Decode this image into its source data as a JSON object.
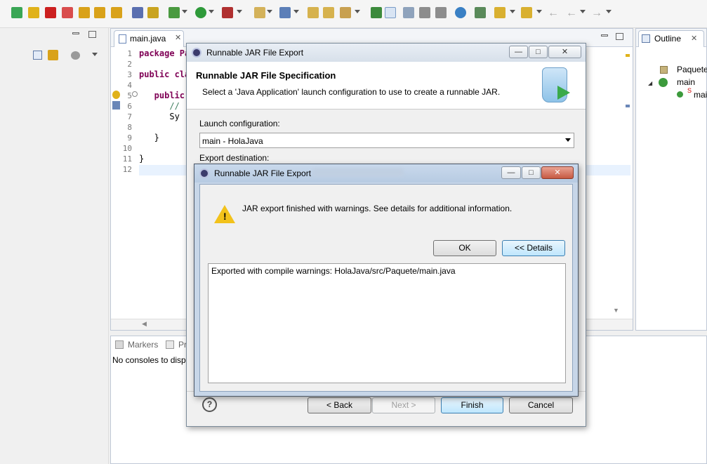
{
  "editor": {
    "tab_label": "main.java",
    "line_numbers": [
      "1",
      "2",
      "3",
      "4",
      "5",
      "6",
      "7",
      "8",
      "9",
      "10",
      "11",
      "12"
    ],
    "code_lines": [
      "package Pa",
      "",
      "public cla",
      "",
      "   public",
      "      //",
      "      Sy",
      "",
      "   }",
      "",
      "}",
      ""
    ]
  },
  "outline": {
    "tab_label": "Outline",
    "items": [
      "Paquete",
      "main",
      "mai"
    ]
  },
  "console": {
    "tabs": [
      "Markers",
      "Pr"
    ],
    "message": "No consoles to disp"
  },
  "export_wizard": {
    "title": "Runnable JAR File Export",
    "header_title": "Runnable JAR File Specification",
    "header_desc": "Select a 'Java Application' launch configuration to use to create a runnable JAR.",
    "launch_label": "Launch configuration:",
    "launch_value": "main - HolaJava",
    "export_label": "Export destination:",
    "back_label": "< Back",
    "next_label": "Next >",
    "finish_label": "Finish",
    "cancel_label": "Cancel",
    "help_label": "?"
  },
  "warning_dialog": {
    "title": "Runnable JAR File Export",
    "message": "JAR export finished with warnings. See details for additional information.",
    "ok_label": "OK",
    "details_label": "<< Details",
    "details_text": "Exported with compile warnings: HolaJava/src/Paquete/main.java"
  },
  "colors": {
    "keyword": "#7f0055",
    "accent": "#3c7fb1"
  }
}
